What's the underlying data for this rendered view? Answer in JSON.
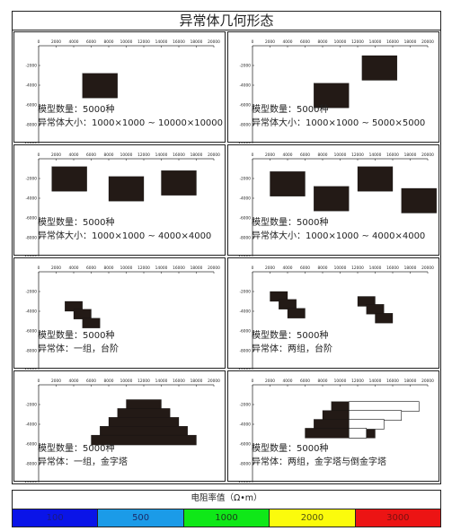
{
  "title": "异常体几何形态",
  "axis": {
    "x_ticks": [
      "0",
      "2000",
      "4000",
      "6000",
      "8000",
      "10000",
      "12000",
      "14000",
      "16000",
      "18000",
      "20000"
    ],
    "y_ticks": [
      "-2000",
      "-4000",
      "-6000",
      "-8000",
      "-10000"
    ]
  },
  "panels": [
    {
      "count": "模型数量：5000种",
      "desc": "异常体大小：1000×1000 ~ 10000×10000",
      "blocks": [
        {
          "x": 5000,
          "y": 2800,
          "w": 4000,
          "h": 2500,
          "fill": "#231a16"
        }
      ]
    },
    {
      "count": "模型数量：5000种",
      "desc": "异常体大小：1000×1000 ~ 5000×5000",
      "blocks": [
        {
          "x": 7000,
          "y": 3800,
          "w": 4000,
          "h": 2500,
          "fill": "#231a16"
        },
        {
          "x": 12500,
          "y": 1000,
          "w": 4000,
          "h": 2500,
          "fill": "#231a16"
        }
      ]
    },
    {
      "count": "模型数量：5000种",
      "desc": "异常体大小：1000×1000 ~ 4000×4000",
      "blocks": [
        {
          "x": 1500,
          "y": 800,
          "w": 4000,
          "h": 2500,
          "fill": "#231a16"
        },
        {
          "x": 8000,
          "y": 1800,
          "w": 4000,
          "h": 2500,
          "fill": "#231a16"
        },
        {
          "x": 14000,
          "y": 1200,
          "w": 4000,
          "h": 2500,
          "fill": "#231a16"
        }
      ]
    },
    {
      "count": "模型数量：5000种",
      "desc": "异常体大小：1000×1000 ~ 4000×4000",
      "blocks": [
        {
          "x": 2000,
          "y": 1300,
          "w": 4000,
          "h": 2500,
          "fill": "#231a16"
        },
        {
          "x": 7000,
          "y": 2800,
          "w": 4000,
          "h": 2500,
          "fill": "#231a16"
        },
        {
          "x": 12000,
          "y": 800,
          "w": 4000,
          "h": 2500,
          "fill": "#231a16"
        },
        {
          "x": 17000,
          "y": 3000,
          "w": 4000,
          "h": 2500,
          "fill": "#231a16"
        }
      ]
    },
    {
      "count": "模型数量：5000种",
      "desc": "异常体：一组，台阶",
      "blocks": [
        {
          "x": 3000,
          "y": 3000,
          "w": 2000,
          "h": 1000,
          "fill": "#231a16"
        },
        {
          "x": 4000,
          "y": 3800,
          "w": 2000,
          "h": 1000,
          "fill": "#231a16"
        },
        {
          "x": 5000,
          "y": 4700,
          "w": 2000,
          "h": 1000,
          "fill": "#231a16"
        }
      ]
    },
    {
      "count": "模型数量：5000种",
      "desc": "异常体：两组，台阶",
      "blocks": [
        {
          "x": 2000,
          "y": 2000,
          "w": 2000,
          "h": 1000,
          "fill": "#231a16"
        },
        {
          "x": 3000,
          "y": 2800,
          "w": 2000,
          "h": 1000,
          "fill": "#231a16"
        },
        {
          "x": 4000,
          "y": 3700,
          "w": 2000,
          "h": 1000,
          "fill": "#231a16"
        },
        {
          "x": 12000,
          "y": 2500,
          "w": 2000,
          "h": 1000,
          "fill": "#231a16"
        },
        {
          "x": 13000,
          "y": 3300,
          "w": 2000,
          "h": 1000,
          "fill": "#231a16"
        },
        {
          "x": 14000,
          "y": 4200,
          "w": 2000,
          "h": 1000,
          "fill": "#231a16"
        }
      ]
    },
    {
      "count": "模型数量：5000种",
      "desc": "异常体：一组，金字塔",
      "blocks": [
        {
          "x": 10000,
          "y": 1500,
          "w": 4000,
          "h": 1000,
          "fill": "#231a16"
        },
        {
          "x": 9000,
          "y": 2400,
          "w": 6000,
          "h": 1000,
          "fill": "#231a16"
        },
        {
          "x": 8000,
          "y": 3300,
          "w": 8000,
          "h": 1000,
          "fill": "#231a16"
        },
        {
          "x": 7000,
          "y": 4200,
          "w": 10000,
          "h": 1000,
          "fill": "#231a16"
        },
        {
          "x": 6000,
          "y": 5100,
          "w": 12000,
          "h": 1000,
          "fill": "#231a16"
        }
      ]
    },
    {
      "count": "模型数量：5000种",
      "desc": "异常体：两组，金字塔与倒金字塔",
      "blocks": [
        {
          "x": 9000,
          "y": 1700,
          "w": 2000,
          "h": 1000,
          "fill": "#231a16"
        },
        {
          "x": 8000,
          "y": 2600,
          "w": 4000,
          "h": 1000,
          "fill": "#231a16"
        },
        {
          "x": 7000,
          "y": 3500,
          "w": 6000,
          "h": 1000,
          "fill": "#231a16"
        },
        {
          "x": 6000,
          "y": 4400,
          "w": 8000,
          "h": 1000,
          "fill": "#231a16"
        },
        {
          "x": 11000,
          "y": 1700,
          "w": 8000,
          "h": 1000,
          "fill": "#ffffff"
        },
        {
          "x": 11000,
          "y": 2600,
          "w": 6000,
          "h": 1000,
          "fill": "#ffffff"
        },
        {
          "x": 11000,
          "y": 3500,
          "w": 4000,
          "h": 1000,
          "fill": "#ffffff"
        },
        {
          "x": 11000,
          "y": 4400,
          "w": 2000,
          "h": 1000,
          "fill": "#ffffff"
        }
      ]
    }
  ],
  "legend": {
    "title": "电阻率值（Ω•m）",
    "items": [
      {
        "label": "100",
        "color": "#0a14e8",
        "text": "#1a1a80"
      },
      {
        "label": "500",
        "color": "#1b9be8",
        "text": "#1a2a6a"
      },
      {
        "label": "1000",
        "color": "#0fe818",
        "text": "#1a3a1a"
      },
      {
        "label": "2000",
        "color": "#fbfb0c",
        "text": "#555510"
      },
      {
        "label": "3000",
        "color": "#ec1414",
        "text": "#7a1010"
      }
    ]
  }
}
